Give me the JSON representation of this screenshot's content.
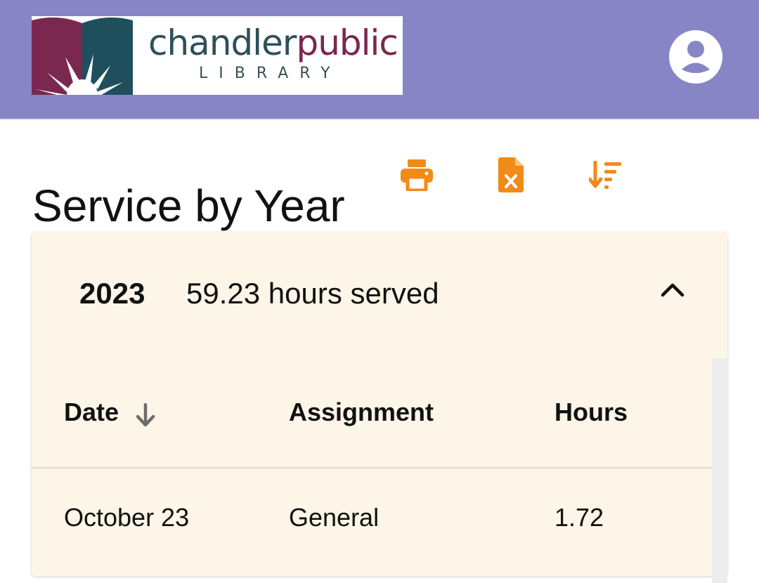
{
  "header": {
    "logo": {
      "word_part1": "chandler",
      "word_part2": "public",
      "subtitle": "LIBRARY"
    },
    "account_icon": "account-circle-icon"
  },
  "page": {
    "title": "Service by Year"
  },
  "toolbar": {
    "print_icon": "print-icon",
    "excel_icon": "excel-export-icon",
    "sort_icon": "sort-descending-icon",
    "accent_color": "#f28a18"
  },
  "year_group": {
    "year": "2023",
    "summary": "59.23 hours served",
    "expanded": true,
    "columns": {
      "date": "Date",
      "assignment": "Assignment",
      "hours": "Hours"
    },
    "sort_indicator": "arrow-down-icon",
    "rows": [
      {
        "date": "October 23",
        "assignment": "General",
        "hours": "1.72"
      }
    ]
  },
  "colors": {
    "header_bg": "#8885c6",
    "card_bg": "#fdf5e7",
    "logo_maroon": "#7a2850",
    "logo_teal": "#2e4f5a"
  }
}
